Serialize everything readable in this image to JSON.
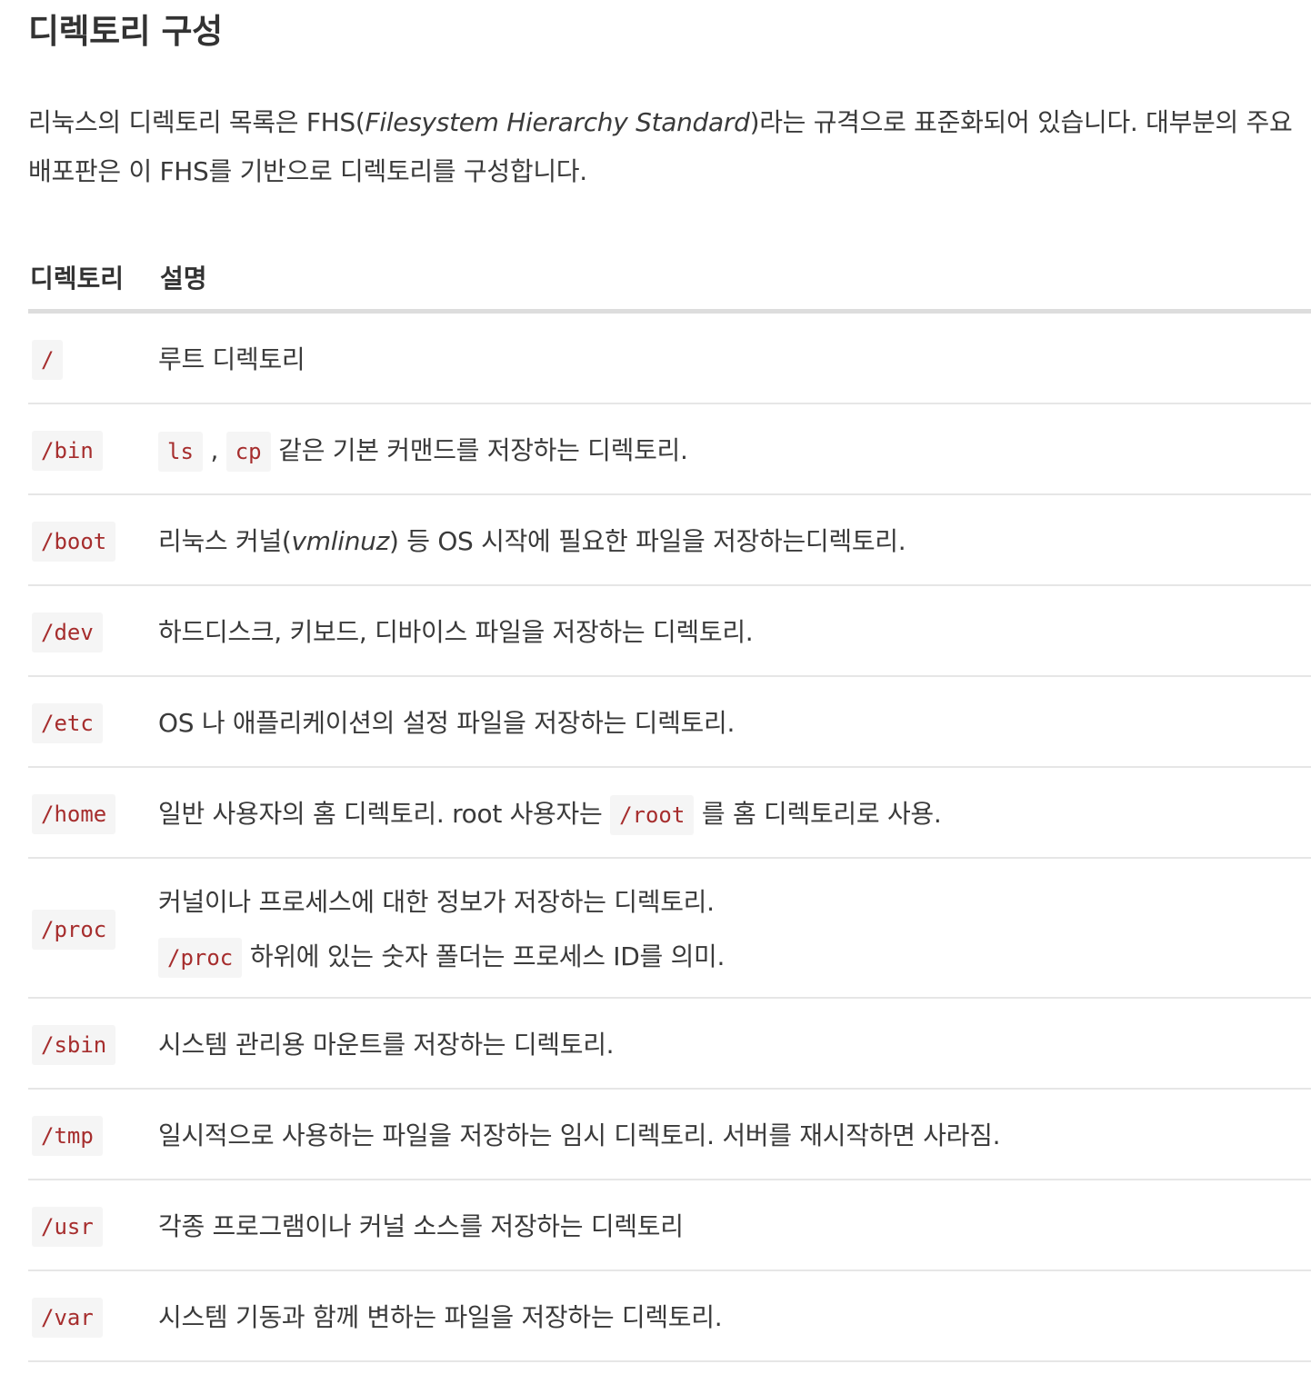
{
  "heading": "디렉토리 구성",
  "intro": {
    "part1": "리눅스의 디렉토리 목록은 FHS(",
    "emphasis": "Filesystem Hierarchy Standard",
    "part2": ")라는 규격으로 표준화되어 있습니다. 대부분의 주요 배포판은 이 FHS를 기반으로 디렉토리를 구성합니다."
  },
  "table": {
    "headers": [
      "디렉토리",
      "설명"
    ],
    "rows": [
      {
        "dir": "/",
        "desc": "루트 디렉토리"
      },
      {
        "dir": "/bin",
        "code1": "ls",
        "sep": ",",
        "code2": "cp",
        "desc": "같은 기본 커맨드를 저장하는 디렉토리."
      },
      {
        "dir": "/boot",
        "desc_a": "리눅스 커널(",
        "emphasis": "vmlinuz",
        "desc_b": ") 등 OS 시작에 필요한 파일을 저장하는디렉토리."
      },
      {
        "dir": "/dev",
        "desc": "하드디스크, 키보드, 디바이스 파일을 저장하는 디렉토리."
      },
      {
        "dir": "/etc",
        "desc": "OS 나 애플리케이션의 설정 파일을 저장하는 디렉토리."
      },
      {
        "dir": "/home",
        "desc_a": "일반 사용자의 홈 디렉토리. root 사용자는",
        "code": "/root",
        "desc_b": "를 홈 디렉토리로 사용."
      },
      {
        "dir": "/proc",
        "desc_line1": "커널이나 프로세스에 대한 정보가 저장하는 디렉토리.",
        "code": "/proc",
        "desc_line2": "하위에 있는 숫자 폴더는 프로세스 ID를 의미."
      },
      {
        "dir": "/sbin",
        "desc": "시스템 관리용 마운트를 저장하는 디렉토리."
      },
      {
        "dir": "/tmp",
        "desc": "일시적으로 사용하는 파일을 저장하는 임시 디렉토리. 서버를 재시작하면 사라짐."
      },
      {
        "dir": "/usr",
        "desc": "각종 프로그램이나 커널 소스를 저장하는 디렉토리"
      },
      {
        "dir": "/var",
        "desc": "시스템 기동과 함께 변하는 파일을 저장하는 디렉토리."
      }
    ]
  },
  "colors": {
    "text": "#333333",
    "code_text": "#a62d2d",
    "code_bg": "#f5f5f5",
    "header_rule": "#dddddd",
    "row_rule": "#e6e6e6"
  }
}
